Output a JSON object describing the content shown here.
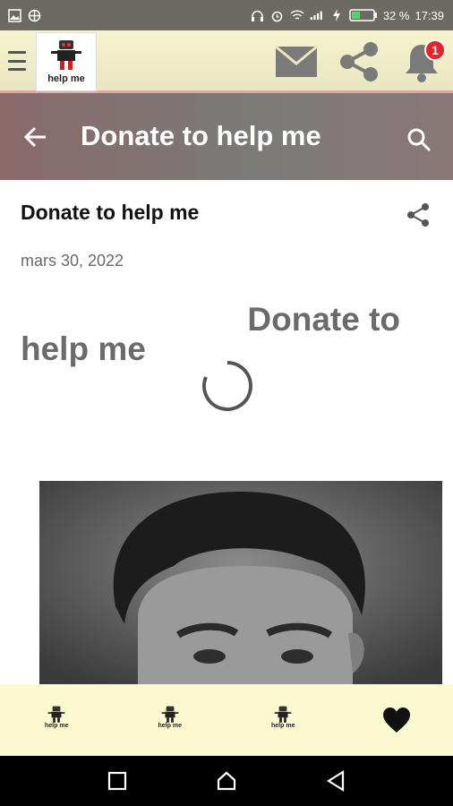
{
  "status_bar": {
    "battery": "32 %",
    "time": "17:39"
  },
  "app_bar": {
    "logo_text": "help me",
    "notification_count": "1"
  },
  "title_bar": {
    "title": "Donate to help me"
  },
  "post": {
    "title": "Donate to help me",
    "date": "mars 30, 2022",
    "heading_line1": "Donate to",
    "heading_line2": "help me"
  },
  "bottom_nav": {
    "items": [
      {
        "label": "help me",
        "icon": "logo-icon"
      },
      {
        "label": "help me",
        "icon": "logo-icon"
      },
      {
        "label": "help me",
        "icon": "logo-icon"
      },
      {
        "label": "",
        "icon": "heart-icon"
      }
    ]
  },
  "colors": {
    "app_bar_bg": "#f5f4cf",
    "title_bar_bg": "#7a7a78",
    "badge": "#e8212b",
    "bottom_nav_bg": "#fbf9cf"
  }
}
